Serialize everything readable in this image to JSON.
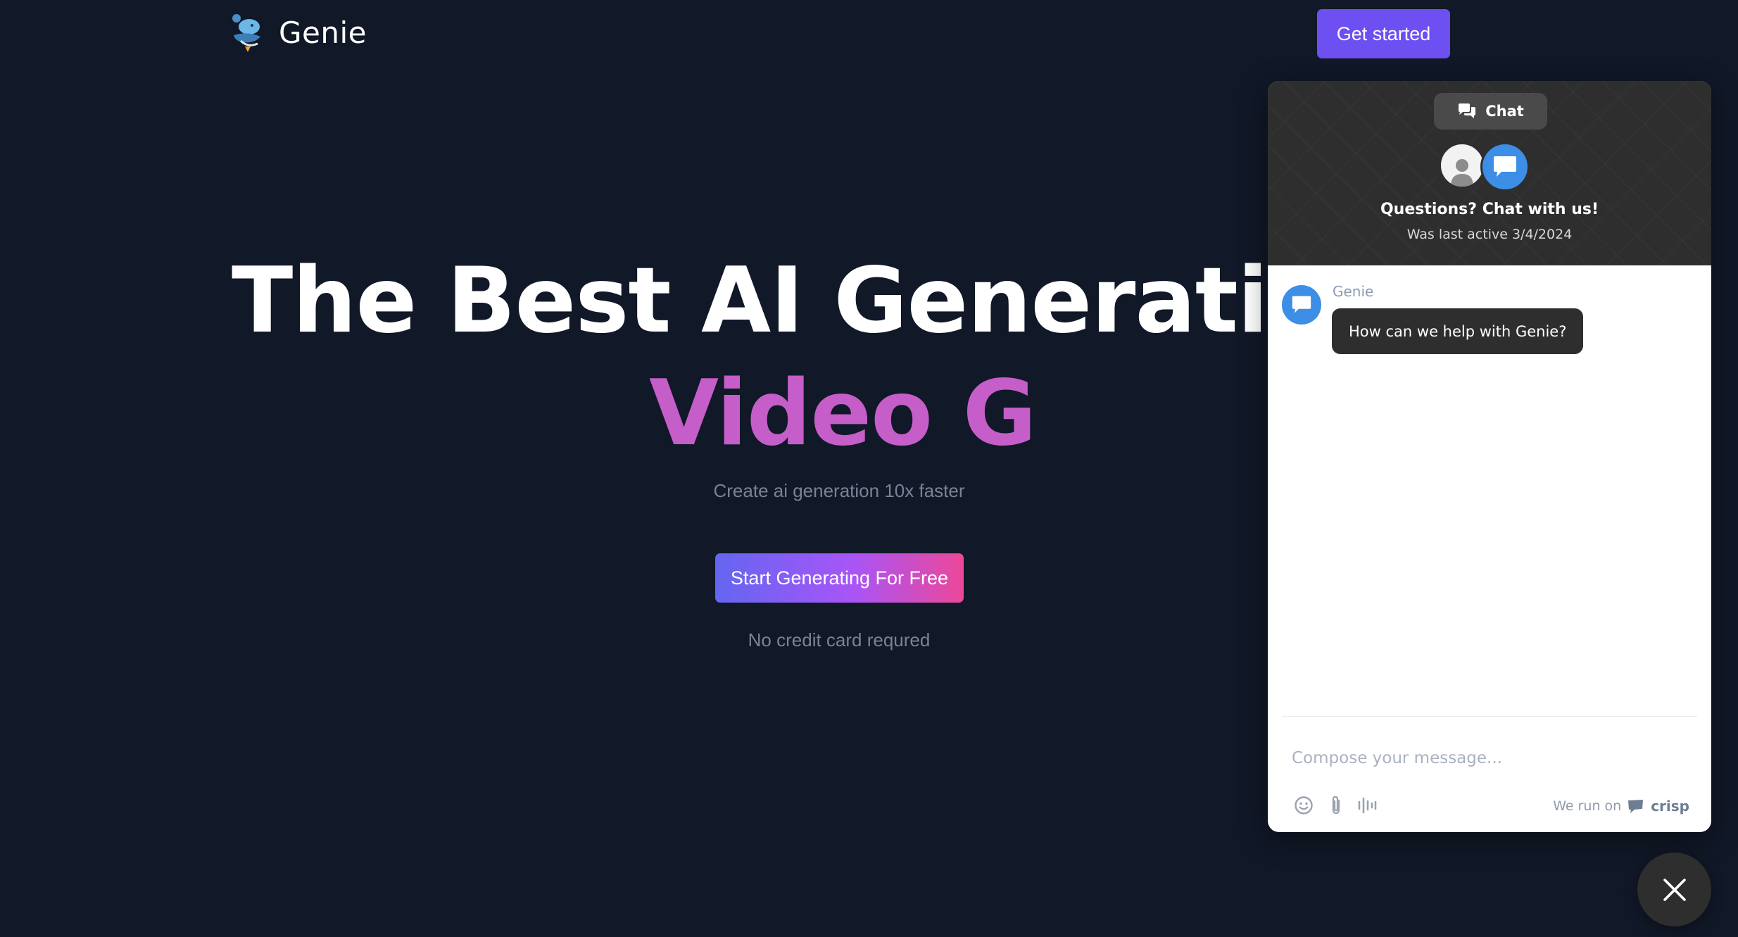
{
  "navbar": {
    "brand": "Genie",
    "cta_label": "Get started"
  },
  "hero": {
    "title_line1": "The Best AI Generation T",
    "title_line2": "Video G",
    "subtitle": "Create ai generation 10x faster",
    "cta_label": "Start Generating For Free",
    "note": "No credit card requred"
  },
  "chat": {
    "tab_label": "Chat",
    "title": "Questions? Chat with us!",
    "status": "Was last active 3/4/2024",
    "messages": [
      {
        "sender": "Genie",
        "text": "How can we help with Genie?"
      }
    ],
    "compose_placeholder": "Compose your message...",
    "toolbar_icons": [
      "emoji-icon",
      "attachment-icon",
      "audio-icon"
    ],
    "powered_by_prefix": "We run on",
    "powered_by_brand": "crisp"
  },
  "colors": {
    "page_background": "#111827",
    "primary_button": "#6d4ff2",
    "hero_accent": "#c55ec8",
    "chat_dark": "#2e2e2e",
    "chat_avatar_blue": "#3d8ee6"
  }
}
